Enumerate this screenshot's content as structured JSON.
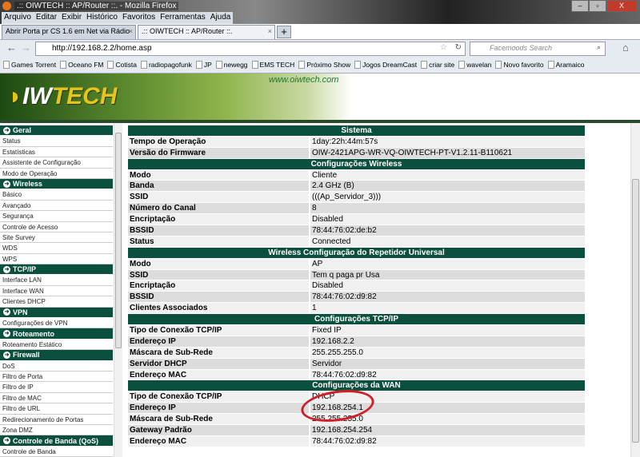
{
  "window": {
    "title": ".:: OIWTECH :: AP/Router ::. - Mozilla Firefox",
    "min": "–",
    "max": "▫",
    "close": "X"
  },
  "menu": [
    "Arquivo",
    "Editar",
    "Exibir",
    "Histórico",
    "Favoritos",
    "Ferramentas",
    "Ajuda"
  ],
  "tabs": [
    {
      "label": "Abrir Porta pr CS 1.6 em Net via Rádio"
    },
    {
      "label": ".:: OIWTECH :: AP/Router ::."
    }
  ],
  "url": "http://192.168.2.2/home.asp",
  "search_placeholder": "Facemoods Search",
  "bookmarks": [
    "Games Torrent",
    "Oceano FM",
    "Cotista",
    "radiopagofunk",
    "JP",
    "newegg",
    "EMS TECH",
    "Próximo Show",
    "Jogos DreamCast",
    "criar site",
    "wavelan",
    "Novo favorito",
    "Aramaico"
  ],
  "banner": {
    "logo": "OIWTECH",
    "site": "www.oiwtech.com"
  },
  "sidebar": [
    {
      "header": "Geral",
      "items": [
        "Status",
        "Estatísticas",
        "Assistente de Configuração",
        "Modo de Operação"
      ]
    },
    {
      "header": "Wireless",
      "items": [
        "Básico",
        "Avançado",
        "Segurança",
        "Controle de Acesso",
        "Site Survey",
        "WDS",
        "WPS"
      ]
    },
    {
      "header": "TCP/IP",
      "items": [
        "Interface LAN",
        "Interface WAN",
        "Clientes DHCP"
      ]
    },
    {
      "header": "VPN",
      "items": [
        "Configurações de VPN"
      ]
    },
    {
      "header": "Roteamento",
      "items": [
        "Roteamento Estático"
      ]
    },
    {
      "header": "Firewall",
      "items": [
        "DoS",
        "Filtro de Porta",
        "Filtro de IP",
        "Filtro de MAC",
        "Filtro de URL",
        "Redirecionamento de Portas",
        "Zona DMZ"
      ]
    },
    {
      "header": "Controle de Banda (QoS)",
      "items": [
        "Controle de Banda"
      ]
    }
  ],
  "sections": [
    {
      "title": "Sistema",
      "rows": [
        [
          "Tempo de Operação",
          "1day:22h:44m:57s"
        ],
        [
          "Versão do Firmware",
          "OIW-2421APG-WR-VQ-OIWTECH-PT-V1.2.11-B110621"
        ]
      ]
    },
    {
      "title": "Configurações Wireless",
      "rows": [
        [
          "Modo",
          "Cliente"
        ],
        [
          "Banda",
          "2.4 GHz (B)"
        ],
        [
          "SSID",
          "(((Ap_Servidor_3)))"
        ],
        [
          "Número do Canal",
          "8"
        ],
        [
          "Encriptação",
          "Disabled"
        ],
        [
          "BSSID",
          "78:44:76:02:de:b2"
        ],
        [
          "Status",
          "Connected"
        ]
      ]
    },
    {
      "title": "Wireless Configuração do Repetidor Universal",
      "rows": [
        [
          "Modo",
          "AP"
        ],
        [
          "SSID",
          "Tem q paga pr Usa"
        ],
        [
          "Encriptação",
          "Disabled"
        ],
        [
          "BSSID",
          "78:44:76:02:d9:82"
        ],
        [
          "Clientes Associados",
          "1"
        ]
      ]
    },
    {
      "title": "Configurações TCP/IP",
      "rows": [
        [
          "Tipo de Conexão TCP/IP",
          "Fixed IP"
        ],
        [
          "Endereço IP",
          "192.168.2.2"
        ],
        [
          "Máscara de Sub-Rede",
          "255.255.255.0"
        ],
        [
          "Servidor DHCP",
          "Servidor"
        ],
        [
          "Endereço MAC",
          "78:44:76:02:d9:82"
        ]
      ]
    },
    {
      "title": "Configurações da WAN",
      "rows": [
        [
          "Tipo de Conexão TCP/IP",
          "DHCP"
        ],
        [
          "Endereço IP",
          "192.168.254.1"
        ],
        [
          "Máscara de Sub-Rede",
          "255.255.255.0"
        ],
        [
          "Gateway Padrão",
          "192.168.254.254"
        ],
        [
          "Endereço MAC",
          "78:44:76:02:d9:82"
        ]
      ]
    }
  ],
  "colors": {
    "header_green": "#0b4f3e",
    "annotation_red": "#d0202a"
  }
}
